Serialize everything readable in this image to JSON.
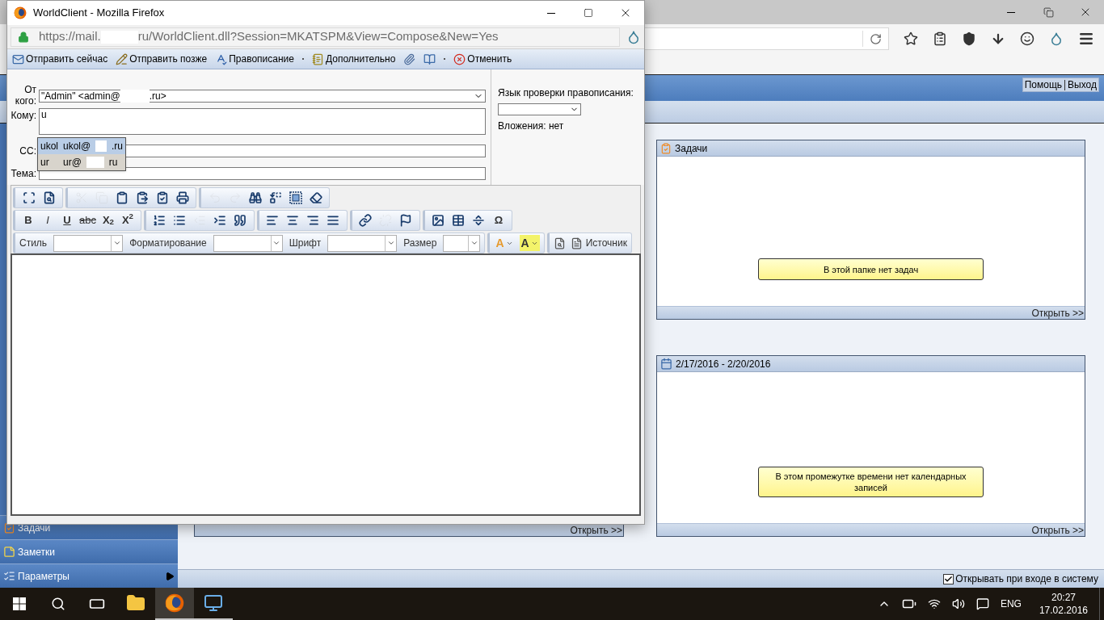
{
  "browser": {
    "header_links": [
      {
        "label": "Помощь"
      },
      {
        "label": "Выход"
      }
    ]
  },
  "sidebar": {
    "items": [
      {
        "label": "Задачи",
        "has_submenu": false
      },
      {
        "label": "Заметки",
        "has_submenu": false
      },
      {
        "label": "Параметры",
        "has_submenu": true
      }
    ]
  },
  "left_panel": {
    "open_link": "Открыть >>"
  },
  "tasks_panel": {
    "title": "Задачи",
    "message": "В этой папке нет задач",
    "open_link": "Открыть >>"
  },
  "calendar_panel": {
    "title": "2/17/2016 - 2/20/2016",
    "message": "В этом промежутке времени нет календарных записей",
    "open_link": "Открыть >>"
  },
  "status_bar": {
    "label": "Открывать при входе в систему",
    "checked": true
  },
  "popup": {
    "title": "WorldClient - Mozilla Firefox",
    "url_start": "https://mail.",
    "url_end": "ru/WorldClient.dll?Session=MKATSPM&View=Compose&New=Yes",
    "actions": [
      {
        "label": "Отправить сейчас"
      },
      {
        "label": "Отправить позже"
      },
      {
        "label": "Правописание"
      },
      {
        "label": "Дополнительно"
      },
      {
        "label": "Отменить"
      }
    ],
    "from": {
      "label": "От кого:",
      "value_start": "\"Admin\" <admin@",
      "value_end": ".ru>"
    },
    "to": {
      "label": "Кому:",
      "value": "u"
    },
    "suggestions": [
      {
        "name": "ukol",
        "email_start": "ukol@",
        "email_end": ".ru",
        "selected": true
      },
      {
        "name": "ur",
        "email_start": "ur@",
        "email_end": "ru",
        "selected": false
      }
    ],
    "cc": {
      "label": "СС:"
    },
    "subject": {
      "label": "Тема:"
    },
    "spell_language": {
      "label": "Язык проверки правописания:"
    },
    "attachments": "Вложения: нет",
    "editor_toolbar": {
      "rows": [
        {
          "groups": [
            [
              {
                "disabled": false
              },
              {
                "disabled": false
              }
            ],
            [
              {
                "disabled": true
              },
              {
                "disabled": true
              },
              {
                "disabled": false
              },
              {
                "disabled": false
              },
              {
                "disabled": false
              },
              {
                "disabled": false
              }
            ],
            [
              {
                "disabled": true
              },
              {
                "disabled": true
              },
              {
                "disabled": false
              },
              {
                "disabled": false
              },
              {
                "disabled": false
              },
              {
                "disabled": false
              }
            ]
          ]
        },
        {
          "groups": [
            [
              {
                "label": "B",
                "kind": "bold",
                "disabled": false
              },
              {
                "label": "I",
                "kind": "italic",
                "disabled": false
              },
              {
                "label": "U",
                "kind": "underline",
                "disabled": false
              },
              {
                "label": "abc",
                "kind": "strike",
                "disabled": false
              },
              {
                "label": "X$_{2}$",
                "kind": "plain",
                "disabled": false
              },
              {
                "label": "X$^{2}$",
                "kind": "plain",
                "disabled": false
              }
            ],
            [
              {
                "disabled": false
              },
              {
                "disabled": false
              },
              {
                "disabled": true
              },
              {
                "disabled": false
              },
              {
                "disabled": false
              }
            ],
            [
              {
                "disabled": false
              },
              {
                "disabled": false
              },
              {
                "disabled": false
              },
              {
                "disabled": false
              }
            ],
            [
              {
                "disabled": false
              },
              {
                "disabled": true
              },
              {
                "disabled": false
              }
            ],
            [
              {
                "disabled": false
              },
              {
                "disabled": false
              },
              {
                "disabled": false
              },
              {
                "label": "Ω",
                "kind": "plain",
                "disabled": false
              }
            ]
          ]
        }
      ],
      "format_fields": [
        {
          "label": "Стиль"
        },
        {
          "label": "Форматирование"
        },
        {
          "label": "Шрифт"
        },
        {
          "label": "Размер"
        }
      ],
      "color_buttons": [
        {
          "label": "A"
        },
        {
          "label": "A"
        }
      ],
      "source_button": {
        "label": "Источник"
      }
    }
  },
  "taskbar": {
    "apps": [
      {
        "selected": false
      },
      {
        "selected": true
      },
      {
        "selected": false
      }
    ],
    "language": "ENG",
    "time": "20:27",
    "date": "17.02.2016"
  }
}
